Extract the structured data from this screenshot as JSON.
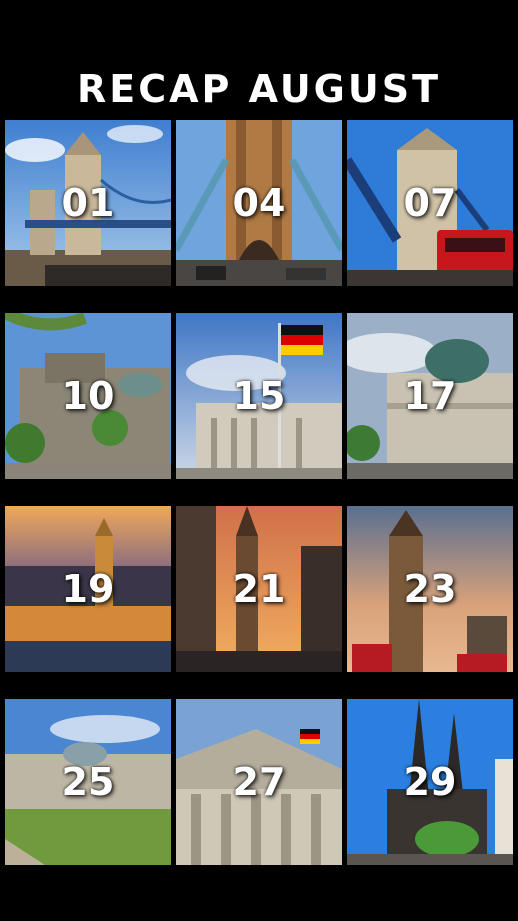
{
  "title": "RECAP AUGUST",
  "tiles": [
    {
      "day": "01",
      "scene": "tower-bridge-river"
    },
    {
      "day": "04",
      "scene": "tower-bridge-deck"
    },
    {
      "day": "07",
      "scene": "tower-bridge-bus"
    },
    {
      "day": "10",
      "scene": "reichstag-tree"
    },
    {
      "day": "15",
      "scene": "reichstag-flag"
    },
    {
      "day": "17",
      "scene": "berlin-cathedral"
    },
    {
      "day": "19",
      "scene": "big-ben-night"
    },
    {
      "day": "21",
      "scene": "big-ben-street-sunset"
    },
    {
      "day": "23",
      "scene": "big-ben-dusk"
    },
    {
      "day": "25",
      "scene": "reichstag-lawn"
    },
    {
      "day": "27",
      "scene": "reichstag-portico"
    },
    {
      "day": "29",
      "scene": "cologne-cathedral"
    }
  ]
}
